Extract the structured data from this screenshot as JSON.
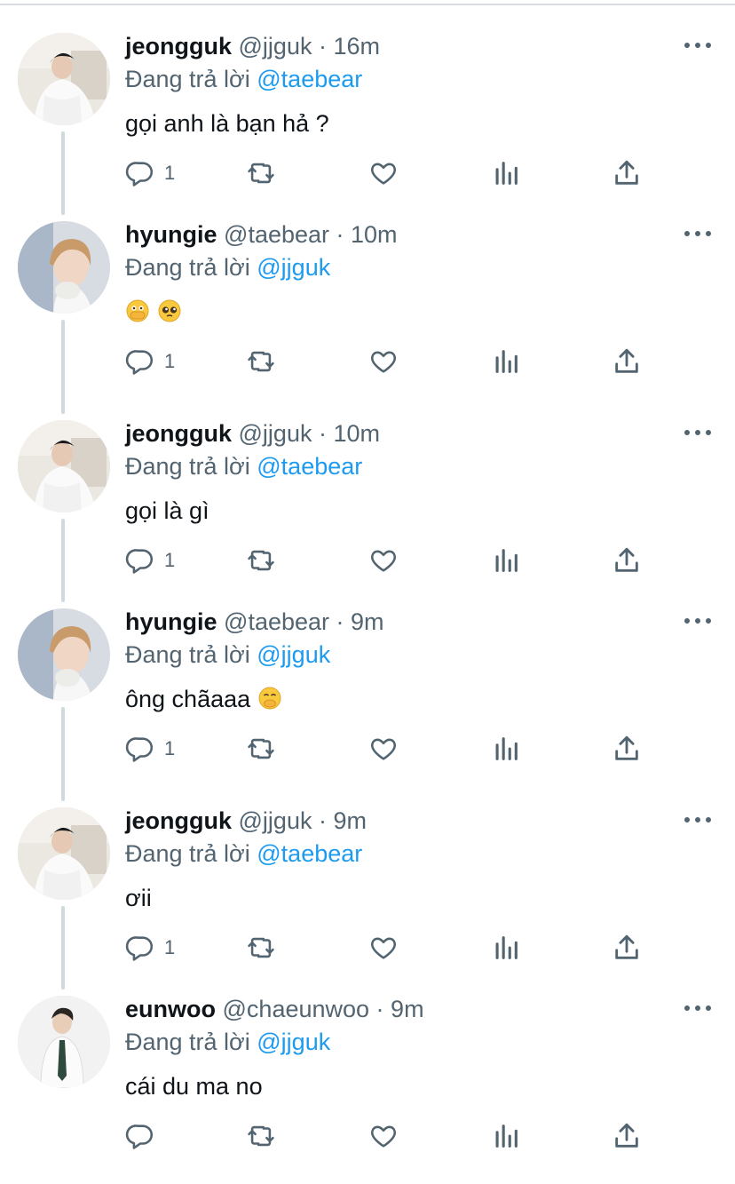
{
  "colors": {
    "accent": "#1d9bf0",
    "secondary_text": "#536471",
    "thread_line": "#cfd9de"
  },
  "tweets": [
    {
      "name": "jeongguk",
      "handle": "@jjguk",
      "sep": " · ",
      "time": "16m",
      "reply_prefix": "Đang trả lời ",
      "reply_to": "@taebear",
      "text": "gọi anh là bạn hả ?",
      "reply_count": "1",
      "avatar": "avatar-jeongguk"
    },
    {
      "name": "hyungie",
      "handle": "@taebear",
      "sep": " · ",
      "time": "10m",
      "reply_prefix": "Đang trả lời ",
      "reply_to": "@jjguk",
      "text": "",
      "emojis": [
        "face-with-open-eyes-and-hand-over-mouth",
        "pleading-face"
      ],
      "reply_count": "1",
      "avatar": "avatar-hyungie"
    },
    {
      "name": "jeongguk",
      "handle": "@jjguk",
      "sep": " · ",
      "time": "10m",
      "reply_prefix": "Đang trả lời ",
      "reply_to": "@taebear",
      "text": "gọi là gì",
      "reply_count": "1",
      "avatar": "avatar-jeongguk"
    },
    {
      "name": "hyungie",
      "handle": "@taebear",
      "sep": " · ",
      "time": "9m",
      "reply_prefix": "Đang trả lời ",
      "reply_to": "@jjguk",
      "text": "ông chãaaa",
      "emojis": [
        "face-with-hand-over-mouth"
      ],
      "reply_count": "1",
      "avatar": "avatar-hyungie"
    },
    {
      "name": "jeongguk",
      "handle": "@jjguk",
      "sep": " · ",
      "time": "9m",
      "reply_prefix": "Đang trả lời ",
      "reply_to": "@taebear",
      "text": "ơii",
      "reply_count": "1",
      "avatar": "avatar-jeongguk"
    },
    {
      "name": "eunwoo",
      "handle": "@chaeunwoo",
      "sep": " · ",
      "time": "9m",
      "reply_prefix": "Đang trả lời ",
      "reply_to": "@jjguk",
      "text": "cái du ma no",
      "reply_count": "",
      "avatar": "avatar-eunwoo"
    }
  ],
  "icons": [
    "reply-icon",
    "retweet-icon",
    "like-icon",
    "analytics-icon",
    "share-icon",
    "more-icon"
  ]
}
